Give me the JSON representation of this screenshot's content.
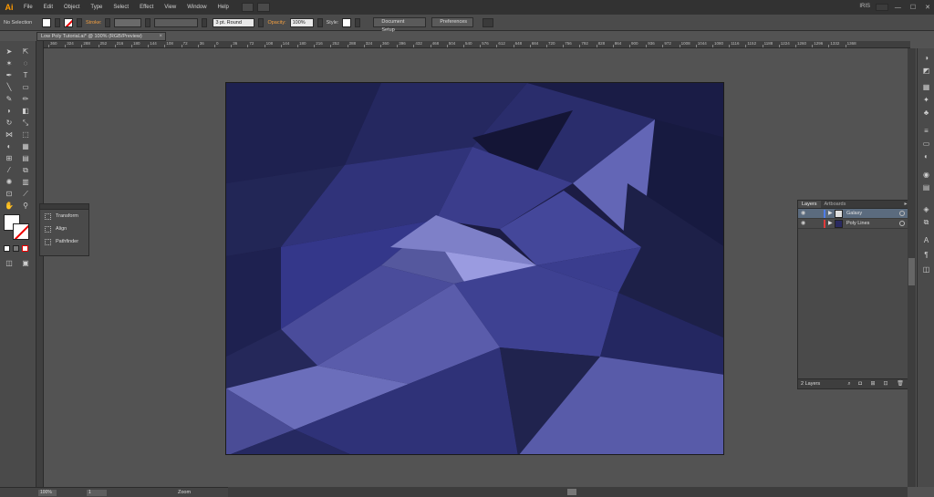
{
  "app": {
    "logo": "Ai"
  },
  "menu": [
    "File",
    "Edit",
    "Object",
    "Type",
    "Select",
    "Effect",
    "View",
    "Window",
    "Help"
  ],
  "window": {
    "workspace": "IRIS",
    "minimize": "—",
    "maximize": "☐",
    "close": "✕"
  },
  "control_bar": {
    "selection": "No Selection",
    "stroke_label": "Stroke:",
    "brush": "3 pt. Round",
    "opacity_label": "Opacity:",
    "opacity_value": "100%",
    "style_label": "Style:",
    "document_setup": "Document Setup",
    "preferences": "Preferences"
  },
  "document_tab": {
    "title": "Low Poly Tutorial.ai* @ 100% (RGB/Preview)",
    "close": "×"
  },
  "ruler_ticks": [
    "360",
    "324",
    "288",
    "252",
    "216",
    "180",
    "144",
    "108",
    "72",
    "36",
    "0",
    "36",
    "72",
    "108",
    "144",
    "180",
    "216",
    "252",
    "288",
    "324",
    "360",
    "396",
    "432",
    "468",
    "504",
    "540",
    "576",
    "612",
    "648",
    "684",
    "720",
    "756",
    "792",
    "828",
    "864",
    "900",
    "936",
    "972",
    "1008",
    "1044",
    "1080",
    "1116",
    "1152",
    "1188",
    "1224",
    "1260",
    "1296",
    "1332",
    "1368"
  ],
  "mini_panel": {
    "items": [
      "Transform",
      "Align",
      "Pathfinder"
    ]
  },
  "layers_panel": {
    "tabs": [
      "Layers",
      "Artboards"
    ],
    "menu_icon": "▸≡",
    "layers": [
      {
        "name": "Galaxy",
        "color": "#4f7de8",
        "selected": true
      },
      {
        "name": "Poly Lines",
        "color": "#e03a3a",
        "selected": false
      }
    ],
    "count": "2 Layers"
  },
  "status_bar": {
    "zoom": "100%",
    "page": "1",
    "status": "Zoom"
  },
  "colors": {
    "accent": "#ff9a00",
    "fill": "#ffffff",
    "stroke_none": "#e00000"
  }
}
